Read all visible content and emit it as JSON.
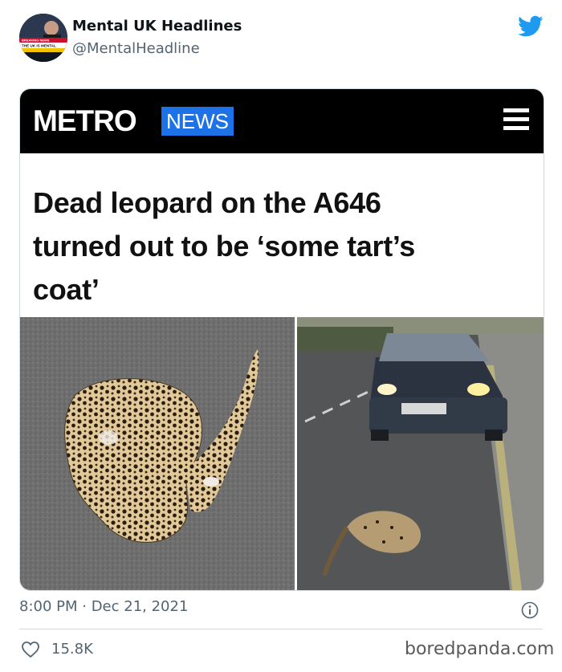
{
  "tweet": {
    "author_name": "Mental UK Headlines",
    "author_handle": "@MentalHeadline",
    "avatar_text": "THE UK IS MENTAL",
    "avatar_banner": "BREAKING NEWS",
    "timestamp": "8:00 PM · Dec 21, 2021",
    "likes": "15.8K"
  },
  "article": {
    "brand": "METRO",
    "section": "NEWS",
    "headline_lines": [
      "Dead leopard on the A646",
      "turned out to be ‘some tart’s",
      "coat’"
    ]
  },
  "watermark": "boredpanda.com",
  "colors": {
    "twitter_blue": "#1d9bf0",
    "metro_blue": "#1c72e6",
    "text_secondary": "#536471",
    "divider": "#cfd9de"
  },
  "icons": [
    "twitter-bird-icon",
    "menu-icon",
    "info-icon",
    "heart-icon"
  ]
}
